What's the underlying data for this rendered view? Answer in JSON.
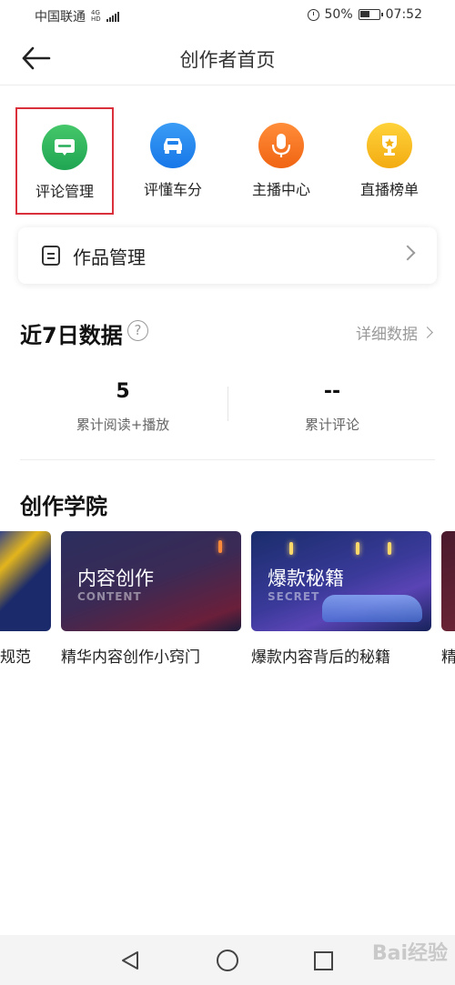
{
  "status_bar": {
    "carrier": "中国联通",
    "network_top": "4G",
    "network_bottom": "HD",
    "battery": "50%",
    "time": "07:52"
  },
  "header": {
    "title": "创作者首页",
    "back_icon": "arrow-left-icon"
  },
  "quick_actions": [
    {
      "label": "评论管理",
      "icon": "comment-icon",
      "color": "#2bb35d",
      "highlighted": true
    },
    {
      "label": "评懂车分",
      "icon": "car-icon",
      "color": "#1f82ec"
    },
    {
      "label": "主播中心",
      "icon": "microphone-icon",
      "color": "#f5741f"
    },
    {
      "label": "直播榜单",
      "icon": "trophy-icon",
      "color": "#f7bd1c"
    }
  ],
  "works": {
    "label": "作品管理",
    "icon": "document-icon"
  },
  "stats_section": {
    "title": "近7日数据",
    "help": "?",
    "detail_link": "详细数据",
    "items": [
      {
        "value": "5",
        "label": "累计阅读+播放"
      },
      {
        "value": "--",
        "label": "累计评论"
      }
    ]
  },
  "academy": {
    "title": "创作学院",
    "courses": [
      {
        "name": "规范",
        "thumb_title": "",
        "thumb_sub": ""
      },
      {
        "name": "精华内容创作小窍门",
        "thumb_title": "内容创作",
        "thumb_sub": "CONTENT"
      },
      {
        "name": "爆款内容背后的秘籍",
        "thumb_title": "爆款秘籍",
        "thumb_sub": "SECRET"
      },
      {
        "name": "精",
        "thumb_title": "",
        "thumb_sub": ""
      }
    ]
  },
  "watermark": "Bai经验"
}
